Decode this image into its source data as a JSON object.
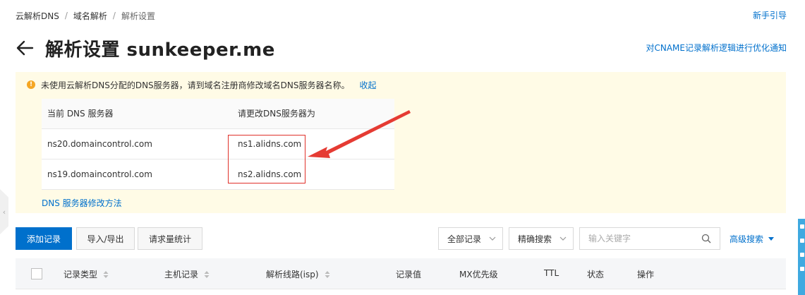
{
  "breadcrumb": {
    "items": [
      "云解析DNS",
      "域名解析",
      "解析设置"
    ]
  },
  "header": {
    "guide_link": "新手引导",
    "title": "解析设置 sunkeeper.me",
    "cname_notice_link": "对CNAME记录解析逻辑进行优化通知"
  },
  "warning": {
    "message": "未使用云解析DNS分配的DNS服务器，请到域名注册商修改域名DNS服务器名称。",
    "collapse": "收起",
    "table": {
      "headers": [
        "当前 DNS 服务器",
        "请更改DNS服务器为"
      ],
      "rows": [
        [
          "ns20.domaincontrol.com",
          "ns1.alidns.com"
        ],
        [
          "ns19.domaincontrol.com",
          "ns2.alidns.com"
        ]
      ]
    },
    "howto_link": "DNS 服务器修改方法"
  },
  "toolbar": {
    "add_record": "添加记录",
    "import_export": "导入/导出",
    "request_stats": "请求量统计",
    "record_filter": "全部记录",
    "search_mode": "精确搜索",
    "keyword_placeholder": "输入关键字",
    "advanced_search": "高级搜索"
  },
  "records_table": {
    "columns": [
      "记录类型",
      "主机记录",
      "解析线路(isp)",
      "记录值",
      "MX优先级",
      "TTL",
      "状态",
      "操作"
    ]
  },
  "colors": {
    "primary": "#0070cc",
    "warning_bg": "#fffbe6",
    "warning_icon": "#f5a623",
    "highlight_red": "#e0312a"
  }
}
